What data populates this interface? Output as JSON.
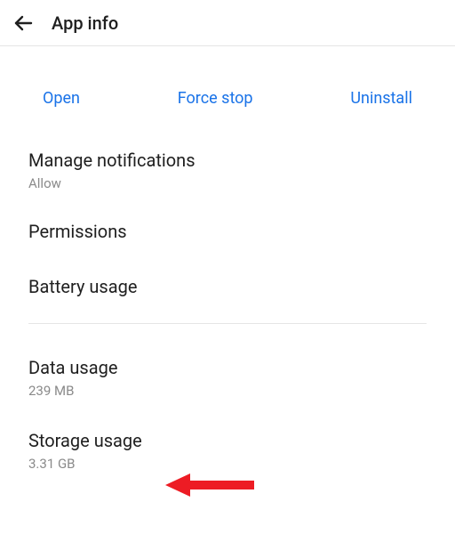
{
  "header": {
    "title": "App info"
  },
  "actions": {
    "open": "Open",
    "force_stop": "Force stop",
    "uninstall": "Uninstall"
  },
  "items": {
    "notifications": {
      "title": "Manage notifications",
      "sub": "Allow"
    },
    "permissions": {
      "title": "Permissions"
    },
    "battery": {
      "title": "Battery usage"
    },
    "data": {
      "title": "Data usage",
      "sub": "239 MB"
    },
    "storage": {
      "title": "Storage usage",
      "sub": "3.31 GB"
    }
  },
  "colors": {
    "accent": "#1a73e8",
    "annotation_arrow": "#ed1c24"
  }
}
